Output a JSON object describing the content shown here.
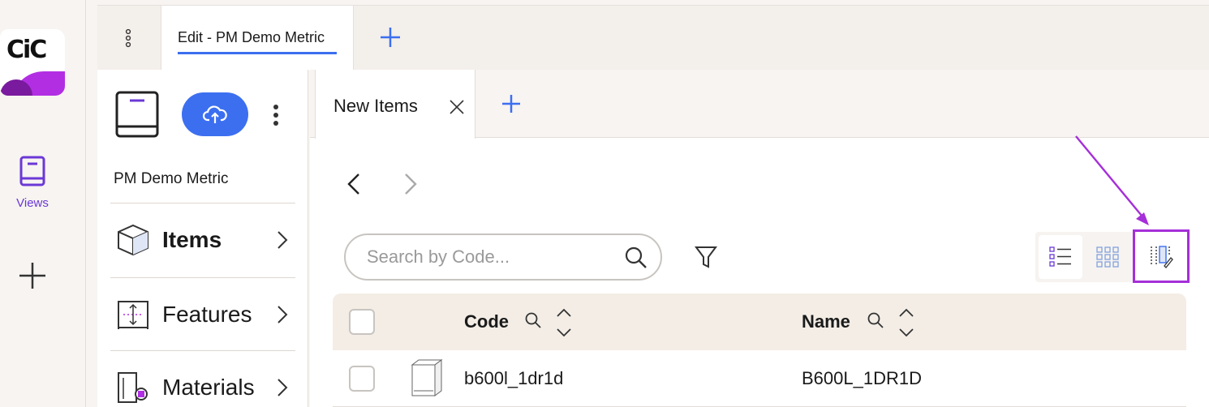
{
  "app": {
    "logo_text": "CiC",
    "brand_color": "#b22ee3",
    "accent_color": "#3c6ff0",
    "rail": {
      "views_label": "Views",
      "views_icon": "book-icon",
      "add_icon": "plus-icon"
    }
  },
  "top_tabs": {
    "menu_icon": "kebab-icon",
    "active_tab_label": "Edit - PM Demo Metric",
    "add_icon": "plus-icon"
  },
  "nav_panel": {
    "catalog_icon": "book-icon",
    "upload_icon": "cloud-upload-icon",
    "menu_icon": "kebab-icon",
    "project_name": "PM Demo Metric",
    "items": [
      {
        "label": "Items",
        "icon": "cube-icon",
        "bold": true
      },
      {
        "label": "Features",
        "icon": "features-icon",
        "bold": false
      },
      {
        "label": "Materials",
        "icon": "materials-icon",
        "bold": false
      }
    ]
  },
  "main": {
    "tab_label": "New Items",
    "close_icon": "close-icon",
    "add_tab_icon": "plus-icon",
    "search": {
      "placeholder": "Search by Code...",
      "value": ""
    },
    "view_toggle": {
      "options": [
        "list-view-icon",
        "grid-view-icon",
        "column-config-icon"
      ],
      "highlight_color": "#a52fd9"
    },
    "table": {
      "columns": [
        "Code",
        "Name"
      ],
      "rows": [
        {
          "code": "b600l_1dr1d",
          "name": "B600L_1DR1D"
        }
      ]
    }
  }
}
